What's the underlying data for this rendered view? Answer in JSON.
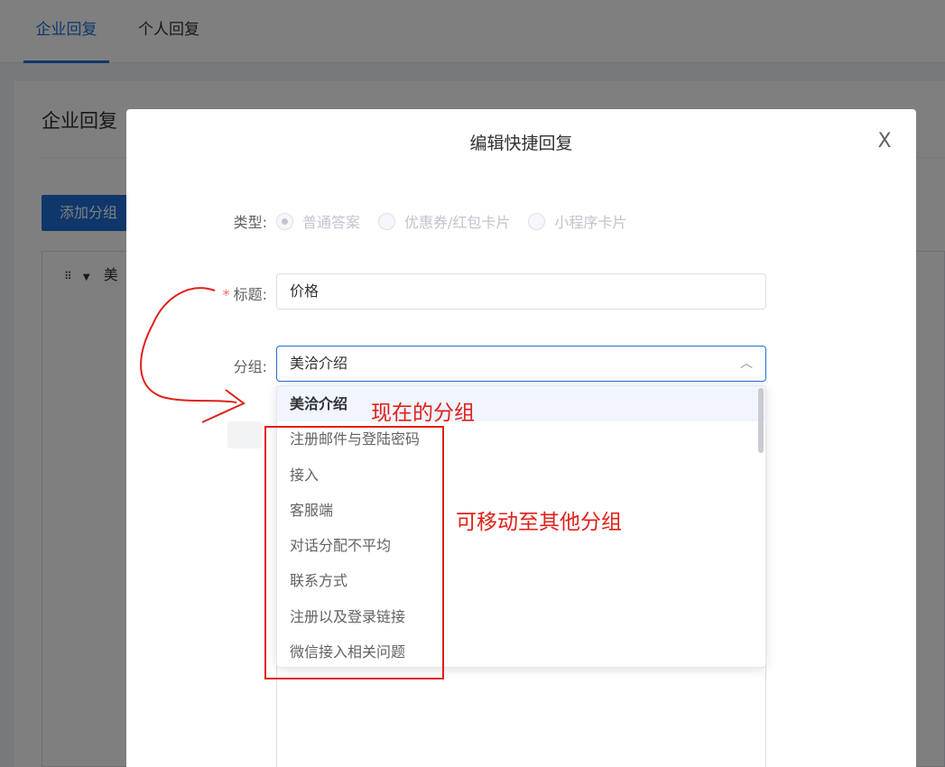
{
  "tabs": [
    {
      "label": "企业回复",
      "active": true
    },
    {
      "label": "个人回复",
      "active": false
    }
  ],
  "page": {
    "title": "企业回复",
    "add_group_label": "添加分组",
    "tree_first_item": "美"
  },
  "dialog": {
    "title": "编辑快捷回复",
    "close_glyph": "X",
    "type_label": "类型:",
    "type_options": [
      {
        "label": "普通答案",
        "checked": true
      },
      {
        "label": "优惠券/红包卡片",
        "checked": false
      },
      {
        "label": "小程序卡片",
        "checked": false
      }
    ],
    "title_label": "标题:",
    "title_required": "*",
    "title_value": "价格",
    "group_label": "分组:",
    "group_value": "美洽介绍",
    "group_options": [
      {
        "label": "美洽介绍",
        "selected": true
      },
      {
        "label": "注册邮件与登陆密码",
        "selected": false
      },
      {
        "label": "接入",
        "selected": false
      },
      {
        "label": "客服端",
        "selected": false
      },
      {
        "label": "对话分配不平均",
        "selected": false
      },
      {
        "label": "联系方式",
        "selected": false
      },
      {
        "label": "注册以及登录链接",
        "selected": false
      },
      {
        "label": "微信接入相关问题",
        "selected": false
      }
    ]
  },
  "annotations": {
    "current_group": "现在的分组",
    "move_to_other": "可移动至其他分组",
    "color": "#e0201a"
  }
}
